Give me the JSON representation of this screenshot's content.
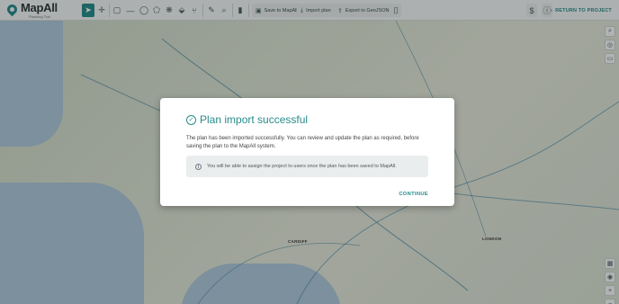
{
  "app": {
    "logo_text": "MapAll",
    "logo_subtitle": "Planning Tool"
  },
  "toolbar": {
    "save_label": "Save to MapAll",
    "import_label": "Import plan",
    "export_label": "Export to GeoJSON",
    "return_label": "RETURN TO PROJECT"
  },
  "map": {
    "labels": [
      "CARDIFF",
      "LONDON"
    ]
  },
  "dialog": {
    "title": "Plan import successful",
    "body": "The plan has been imported successfully. You can review and update the plan as required, before saving the plan to the MapAll system.",
    "info": "You will be able to assign the project to users once the plan has been saved to MapAll.",
    "continue_label": "CONTINUE"
  },
  "colors": {
    "accent": "#2a8b8b"
  }
}
